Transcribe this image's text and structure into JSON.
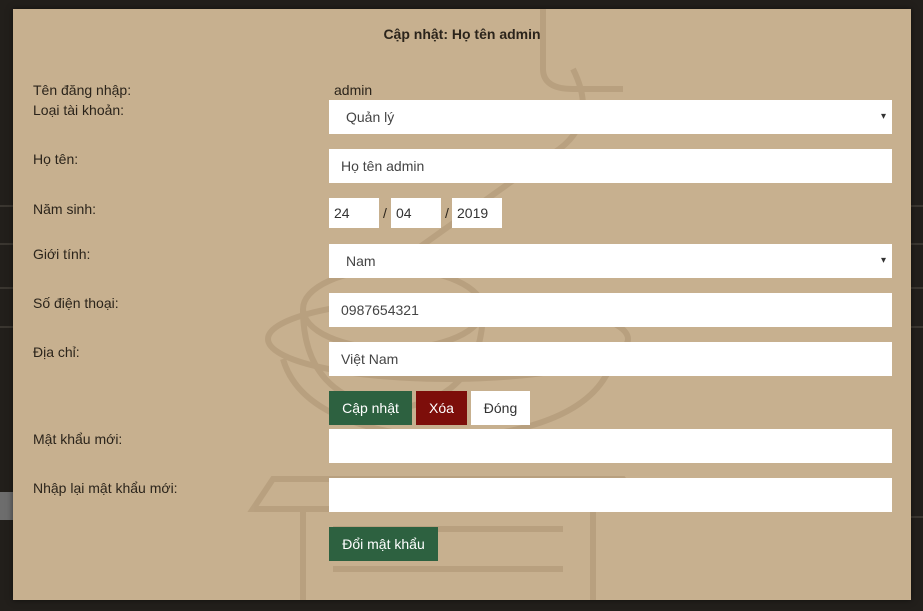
{
  "title": "Cập nhật: Họ tên admin",
  "labels": {
    "username": "Tên đăng nhập:",
    "account_type": "Loại tài khoản:",
    "fullname": "Họ tên:",
    "birth_year": "Năm sinh:",
    "gender": "Giới tính:",
    "phone": "Số điện thoại:",
    "address": "Địa chỉ:",
    "new_password": "Mật khẩu mới:",
    "confirm_password": "Nhập lại mật khẩu mới:"
  },
  "values": {
    "username": "admin",
    "account_type": "Quản lý",
    "fullname": "Họ tên admin",
    "birth_day": "24",
    "birth_month": "04",
    "birth_year": "2019",
    "date_separator": "/",
    "gender": "Nam",
    "phone": "0987654321",
    "address": "Việt Nam",
    "new_password": "",
    "confirm_password": ""
  },
  "buttons": {
    "update": "Cập nhật",
    "delete": "Xóa",
    "close": "Đóng",
    "change_password": "Đổi mật khẩu"
  },
  "icons": {
    "select_caret": "▾"
  },
  "colors": {
    "modal_bg": "#c7b08f",
    "primary_green": "#2d6140",
    "danger_red": "#7d0e0a",
    "page_bg": "#221f1b"
  }
}
